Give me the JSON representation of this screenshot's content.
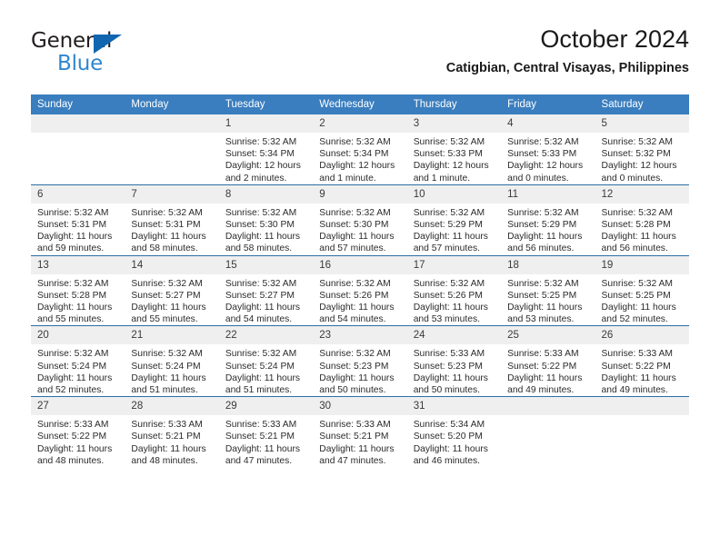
{
  "brand": {
    "name_part1": "General",
    "name_part2": "Blue",
    "logo_icon": "triangle-logo-icon"
  },
  "header": {
    "title": "October 2024",
    "subtitle": "Catigbian, Central Visayas, Philippines"
  },
  "colors": {
    "header_blue": "#3a7ebf",
    "rule_blue": "#2e6da4",
    "daynum_bg": "#efefef",
    "brand_blue": "#2e86d1",
    "logo_blue": "#1266b0"
  },
  "weekdays": [
    "Sunday",
    "Monday",
    "Tuesday",
    "Wednesday",
    "Thursday",
    "Friday",
    "Saturday"
  ],
  "weeks": [
    [
      {
        "day": "",
        "sunrise": "",
        "sunset": "",
        "daylight": ""
      },
      {
        "day": "",
        "sunrise": "",
        "sunset": "",
        "daylight": ""
      },
      {
        "day": "1",
        "sunrise": "Sunrise: 5:32 AM",
        "sunset": "Sunset: 5:34 PM",
        "daylight": "Daylight: 12 hours and 2 minutes."
      },
      {
        "day": "2",
        "sunrise": "Sunrise: 5:32 AM",
        "sunset": "Sunset: 5:34 PM",
        "daylight": "Daylight: 12 hours and 1 minute."
      },
      {
        "day": "3",
        "sunrise": "Sunrise: 5:32 AM",
        "sunset": "Sunset: 5:33 PM",
        "daylight": "Daylight: 12 hours and 1 minute."
      },
      {
        "day": "4",
        "sunrise": "Sunrise: 5:32 AM",
        "sunset": "Sunset: 5:33 PM",
        "daylight": "Daylight: 12 hours and 0 minutes."
      },
      {
        "day": "5",
        "sunrise": "Sunrise: 5:32 AM",
        "sunset": "Sunset: 5:32 PM",
        "daylight": "Daylight: 12 hours and 0 minutes."
      }
    ],
    [
      {
        "day": "6",
        "sunrise": "Sunrise: 5:32 AM",
        "sunset": "Sunset: 5:31 PM",
        "daylight": "Daylight: 11 hours and 59 minutes."
      },
      {
        "day": "7",
        "sunrise": "Sunrise: 5:32 AM",
        "sunset": "Sunset: 5:31 PM",
        "daylight": "Daylight: 11 hours and 58 minutes."
      },
      {
        "day": "8",
        "sunrise": "Sunrise: 5:32 AM",
        "sunset": "Sunset: 5:30 PM",
        "daylight": "Daylight: 11 hours and 58 minutes."
      },
      {
        "day": "9",
        "sunrise": "Sunrise: 5:32 AM",
        "sunset": "Sunset: 5:30 PM",
        "daylight": "Daylight: 11 hours and 57 minutes."
      },
      {
        "day": "10",
        "sunrise": "Sunrise: 5:32 AM",
        "sunset": "Sunset: 5:29 PM",
        "daylight": "Daylight: 11 hours and 57 minutes."
      },
      {
        "day": "11",
        "sunrise": "Sunrise: 5:32 AM",
        "sunset": "Sunset: 5:29 PM",
        "daylight": "Daylight: 11 hours and 56 minutes."
      },
      {
        "day": "12",
        "sunrise": "Sunrise: 5:32 AM",
        "sunset": "Sunset: 5:28 PM",
        "daylight": "Daylight: 11 hours and 56 minutes."
      }
    ],
    [
      {
        "day": "13",
        "sunrise": "Sunrise: 5:32 AM",
        "sunset": "Sunset: 5:28 PM",
        "daylight": "Daylight: 11 hours and 55 minutes."
      },
      {
        "day": "14",
        "sunrise": "Sunrise: 5:32 AM",
        "sunset": "Sunset: 5:27 PM",
        "daylight": "Daylight: 11 hours and 55 minutes."
      },
      {
        "day": "15",
        "sunrise": "Sunrise: 5:32 AM",
        "sunset": "Sunset: 5:27 PM",
        "daylight": "Daylight: 11 hours and 54 minutes."
      },
      {
        "day": "16",
        "sunrise": "Sunrise: 5:32 AM",
        "sunset": "Sunset: 5:26 PM",
        "daylight": "Daylight: 11 hours and 54 minutes."
      },
      {
        "day": "17",
        "sunrise": "Sunrise: 5:32 AM",
        "sunset": "Sunset: 5:26 PM",
        "daylight": "Daylight: 11 hours and 53 minutes."
      },
      {
        "day": "18",
        "sunrise": "Sunrise: 5:32 AM",
        "sunset": "Sunset: 5:25 PM",
        "daylight": "Daylight: 11 hours and 53 minutes."
      },
      {
        "day": "19",
        "sunrise": "Sunrise: 5:32 AM",
        "sunset": "Sunset: 5:25 PM",
        "daylight": "Daylight: 11 hours and 52 minutes."
      }
    ],
    [
      {
        "day": "20",
        "sunrise": "Sunrise: 5:32 AM",
        "sunset": "Sunset: 5:24 PM",
        "daylight": "Daylight: 11 hours and 52 minutes."
      },
      {
        "day": "21",
        "sunrise": "Sunrise: 5:32 AM",
        "sunset": "Sunset: 5:24 PM",
        "daylight": "Daylight: 11 hours and 51 minutes."
      },
      {
        "day": "22",
        "sunrise": "Sunrise: 5:32 AM",
        "sunset": "Sunset: 5:24 PM",
        "daylight": "Daylight: 11 hours and 51 minutes."
      },
      {
        "day": "23",
        "sunrise": "Sunrise: 5:32 AM",
        "sunset": "Sunset: 5:23 PM",
        "daylight": "Daylight: 11 hours and 50 minutes."
      },
      {
        "day": "24",
        "sunrise": "Sunrise: 5:33 AM",
        "sunset": "Sunset: 5:23 PM",
        "daylight": "Daylight: 11 hours and 50 minutes."
      },
      {
        "day": "25",
        "sunrise": "Sunrise: 5:33 AM",
        "sunset": "Sunset: 5:22 PM",
        "daylight": "Daylight: 11 hours and 49 minutes."
      },
      {
        "day": "26",
        "sunrise": "Sunrise: 5:33 AM",
        "sunset": "Sunset: 5:22 PM",
        "daylight": "Daylight: 11 hours and 49 minutes."
      }
    ],
    [
      {
        "day": "27",
        "sunrise": "Sunrise: 5:33 AM",
        "sunset": "Sunset: 5:22 PM",
        "daylight": "Daylight: 11 hours and 48 minutes."
      },
      {
        "day": "28",
        "sunrise": "Sunrise: 5:33 AM",
        "sunset": "Sunset: 5:21 PM",
        "daylight": "Daylight: 11 hours and 48 minutes."
      },
      {
        "day": "29",
        "sunrise": "Sunrise: 5:33 AM",
        "sunset": "Sunset: 5:21 PM",
        "daylight": "Daylight: 11 hours and 47 minutes."
      },
      {
        "day": "30",
        "sunrise": "Sunrise: 5:33 AM",
        "sunset": "Sunset: 5:21 PM",
        "daylight": "Daylight: 11 hours and 47 minutes."
      },
      {
        "day": "31",
        "sunrise": "Sunrise: 5:34 AM",
        "sunset": "Sunset: 5:20 PM",
        "daylight": "Daylight: 11 hours and 46 minutes."
      },
      {
        "day": "",
        "sunrise": "",
        "sunset": "",
        "daylight": ""
      },
      {
        "day": "",
        "sunrise": "",
        "sunset": "",
        "daylight": ""
      }
    ]
  ]
}
